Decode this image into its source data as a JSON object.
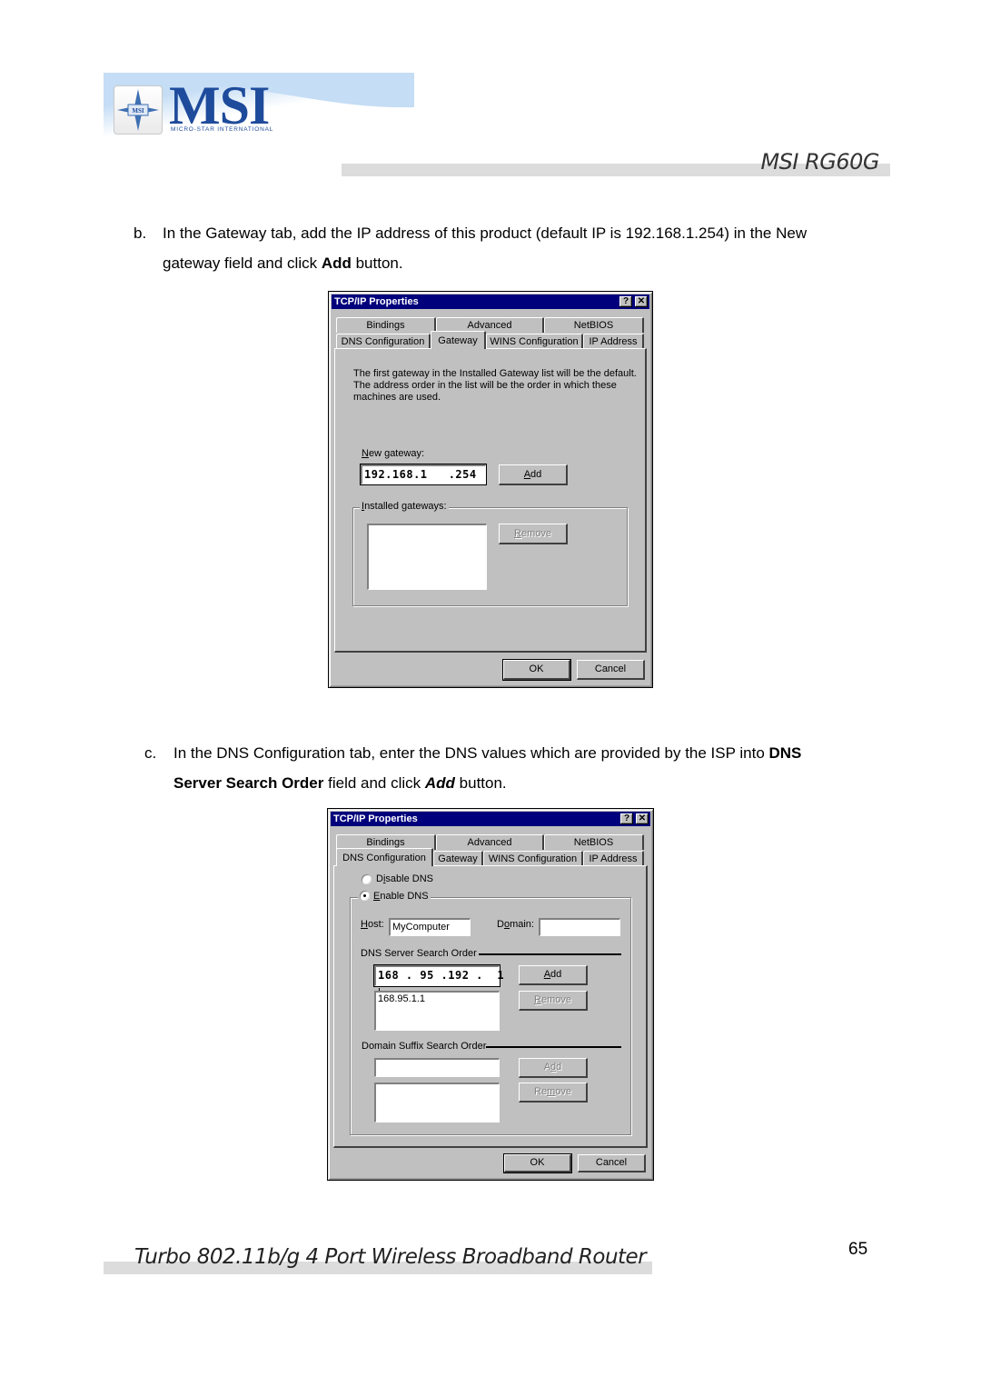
{
  "header": {
    "logo_text": "MSI",
    "logo_badge": "MSI",
    "logo_subtitle": "MICRO-STAR INTERNATIONAL",
    "product_title": "MSI RG60G"
  },
  "step_b": {
    "marker": "b.",
    "text_1": "In the Gateway tab, add the IP address of this product (default IP is 192.168.1.254) in the New",
    "text_2a": "gateway field and click ",
    "text_2b": "Add",
    "text_2c": " button."
  },
  "dialog_gateway": {
    "title": "TCP/IP Properties",
    "help_icon": "?",
    "close_icon": "✕",
    "tabs_row1": [
      "Bindings",
      "Advanced",
      "NetBIOS"
    ],
    "tabs_row2": [
      "DNS Configuration",
      "Gateway",
      "WINS Configuration",
      "IP Address"
    ],
    "active_tab": "Gateway",
    "info_text": [
      "The first gateway in the Installed Gateway list will be the default.",
      "The address order in the list will be the order in which these",
      "machines are used."
    ],
    "new_gateway_label_u": "N",
    "new_gateway_label_rest": "ew gateway:",
    "new_gateway_value": "192.168.1   .254",
    "add_label_u": "A",
    "add_label_rest": "dd",
    "installed_label_u": "I",
    "installed_label_rest": "nstalled gateways:",
    "remove_label_u": "R",
    "remove_label_rest": "emove",
    "ok_label": "OK",
    "cancel_label": "Cancel"
  },
  "step_c": {
    "marker": "c.",
    "text_1a": "In the DNS Configuration tab, enter the DNS values which are provided by the ISP into ",
    "text_1b": "DNS",
    "text_2a": "Server Search Order",
    "text_2b": " field and click ",
    "text_2c": "Add",
    "text_2d": " button."
  },
  "dialog_dns": {
    "title": "TCP/IP Properties",
    "help_icon": "?",
    "close_icon": "✕",
    "tabs_row1": [
      "Bindings",
      "Advanced",
      "NetBIOS"
    ],
    "tabs_row2": [
      "DNS Configuration",
      "Gateway",
      "WINS Configuration",
      "IP Address"
    ],
    "active_tab": "DNS Configuration",
    "disable_dns_pre": "D",
    "disable_dns_u": "i",
    "disable_dns_rest": "sable DNS",
    "enable_dns_u": "E",
    "enable_dns_rest": "nable DNS",
    "selected_radio": "Enable DNS",
    "host_label_u": "H",
    "host_label_rest": "ost:",
    "host_value": "MyComputer",
    "domain_label_pre": "D",
    "domain_label_u": "o",
    "domain_label_rest": "main:",
    "domain_value": "",
    "dns_order_label": "DNS Server Search Order",
    "dns_input_value": "168 . 95 .192 .  1",
    "dns_list": [
      "168.95.1.1"
    ],
    "add_label_u": "A",
    "add_label_rest": "dd",
    "remove_label_u": "R",
    "remove_label_rest": "emove",
    "suffix_label": "Domain Suffix Search Order",
    "suffix_input_value": "",
    "suffix_add_pre": "A",
    "suffix_add_u": "d",
    "suffix_add_rest": "d",
    "suffix_remove_pre": "Re",
    "suffix_remove_u": "m",
    "suffix_remove_rest": "ove",
    "ok_label": "OK",
    "cancel_label": "Cancel"
  },
  "footer": {
    "product_name": "Turbo 802.11b/g 4 Port Wireless Broadband Router",
    "page_number": "65"
  }
}
